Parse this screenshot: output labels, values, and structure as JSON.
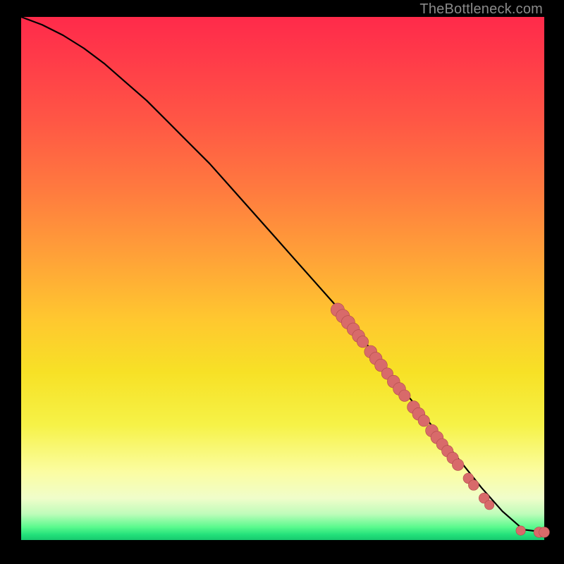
{
  "attribution": "TheBottleneck.com",
  "colors": {
    "background": "#000000",
    "gradient_top": "#ff2a4a",
    "gradient_mid": "#f7e126",
    "gradient_bottom": "#18c86e",
    "line": "#000000",
    "marker_fill": "#d86a6a",
    "marker_stroke": "#b04a4a"
  },
  "chart_data": {
    "type": "line",
    "title": "",
    "xlabel": "",
    "ylabel": "",
    "xlim": [
      0,
      100
    ],
    "ylim": [
      0,
      100
    ],
    "grid": false,
    "legend": false,
    "series": [
      {
        "name": "bottleneck-curve",
        "x": [
          0,
          4,
          8,
          12,
          16,
          20,
          24,
          28,
          32,
          36,
          40,
          44,
          48,
          52,
          56,
          60,
          64,
          68,
          72,
          76,
          80,
          84,
          88,
          92,
          96,
          100
        ],
        "y": [
          100,
          98.5,
          96.5,
          94,
          91,
          87.5,
          84,
          80,
          76,
          72,
          67.5,
          63,
          58.5,
          54,
          49.5,
          45,
          40,
          35,
          30,
          25,
          20,
          15,
          10,
          5.5,
          2,
          1.5
        ]
      }
    ],
    "markers": [
      {
        "x": 60.5,
        "y": 44.0,
        "r": 1.3
      },
      {
        "x": 61.5,
        "y": 42.8,
        "r": 1.3
      },
      {
        "x": 62.5,
        "y": 41.6,
        "r": 1.3
      },
      {
        "x": 63.5,
        "y": 40.3,
        "r": 1.2
      },
      {
        "x": 64.5,
        "y": 39.0,
        "r": 1.2
      },
      {
        "x": 65.3,
        "y": 37.9,
        "r": 1.1
      },
      {
        "x": 66.8,
        "y": 36.0,
        "r": 1.2
      },
      {
        "x": 67.8,
        "y": 34.7,
        "r": 1.2
      },
      {
        "x": 68.8,
        "y": 33.4,
        "r": 1.2
      },
      {
        "x": 70.0,
        "y": 31.8,
        "r": 1.1
      },
      {
        "x": 71.2,
        "y": 30.3,
        "r": 1.2
      },
      {
        "x": 72.3,
        "y": 28.9,
        "r": 1.2
      },
      {
        "x": 73.3,
        "y": 27.6,
        "r": 1.1
      },
      {
        "x": 75.0,
        "y": 25.4,
        "r": 1.2
      },
      {
        "x": 76.0,
        "y": 24.1,
        "r": 1.2
      },
      {
        "x": 77.0,
        "y": 22.8,
        "r": 1.1
      },
      {
        "x": 78.5,
        "y": 20.9,
        "r": 1.2
      },
      {
        "x": 79.5,
        "y": 19.6,
        "r": 1.2
      },
      {
        "x": 80.5,
        "y": 18.3,
        "r": 1.1
      },
      {
        "x": 81.5,
        "y": 17.0,
        "r": 1.1
      },
      {
        "x": 82.5,
        "y": 15.7,
        "r": 1.1
      },
      {
        "x": 83.5,
        "y": 14.4,
        "r": 1.1
      },
      {
        "x": 85.5,
        "y": 11.8,
        "r": 1.0
      },
      {
        "x": 86.5,
        "y": 10.5,
        "r": 1.0
      },
      {
        "x": 88.5,
        "y": 8.0,
        "r": 1.0
      },
      {
        "x": 89.5,
        "y": 6.7,
        "r": 0.9
      },
      {
        "x": 95.5,
        "y": 1.8,
        "r": 0.9
      },
      {
        "x": 99.0,
        "y": 1.5,
        "r": 1.0
      },
      {
        "x": 100.0,
        "y": 1.5,
        "r": 1.0
      }
    ]
  }
}
